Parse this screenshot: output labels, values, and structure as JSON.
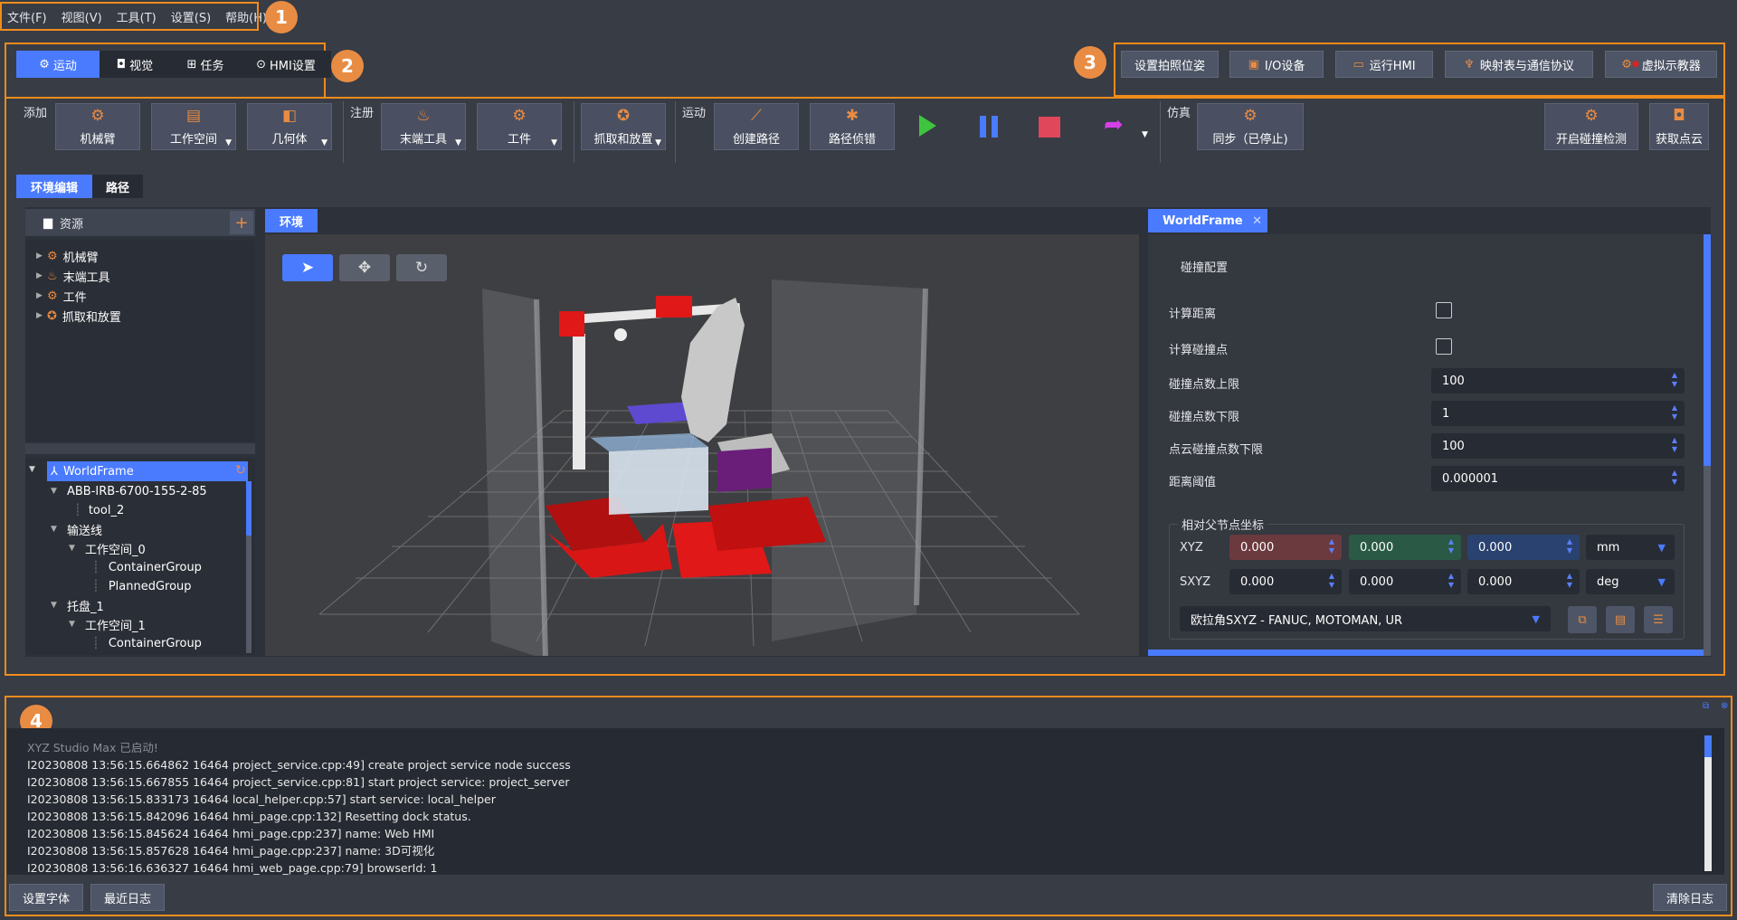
{
  "menu": [
    "文件(F)",
    "视图(V)",
    "工具(T)",
    "设置(S)",
    "帮助(H)"
  ],
  "badges": [
    "1",
    "2",
    "3",
    "4"
  ],
  "main_tabs": [
    {
      "label": "运动",
      "icon": "robot-arm-icon",
      "active": true
    },
    {
      "label": "视觉",
      "icon": "camera-icon",
      "active": false
    },
    {
      "label": "任务",
      "icon": "flow-icon",
      "active": false
    },
    {
      "label": "HMI设置",
      "icon": "play-circle-icon",
      "active": false
    }
  ],
  "top_buttons": [
    "设置拍照位姿",
    "I/O设备",
    "运行HMI",
    "映射表与通信协议",
    "虚拟示教器"
  ],
  "toolbar": {
    "add_label": "添加",
    "register_label": "注册",
    "motion_label": "运动",
    "sim_label": "仿真",
    "add": [
      "机械臂",
      "工作空间",
      "几何体"
    ],
    "register": [
      "末端工具",
      "工件",
      "抓取和放置"
    ],
    "motion": [
      "创建路径",
      "路径侦错"
    ],
    "sim": [
      "同步（已停止)"
    ],
    "right": [
      "开启碰撞检测",
      "获取点云"
    ]
  },
  "sub_tabs": [
    "环境编辑",
    "路径"
  ],
  "resources": {
    "title": "资源",
    "items": [
      "机械臂",
      "末端工具",
      "工件",
      "抓取和放置"
    ]
  },
  "scene_tree": [
    {
      "label": "WorldFrame",
      "level": 0,
      "selected": true
    },
    {
      "label": "ABB-IRB-6700-155-2-85",
      "level": 1
    },
    {
      "label": "tool_2",
      "level": 2
    },
    {
      "label": "输送线",
      "level": 1
    },
    {
      "label": "工作空间_0",
      "level": 2
    },
    {
      "label": "ContainerGroup",
      "level": 3
    },
    {
      "label": "PlannedGroup",
      "level": 3
    },
    {
      "label": "托盘_1",
      "level": 1
    },
    {
      "label": "工作空间_1",
      "level": 2
    },
    {
      "label": "ContainerGroup",
      "level": 3
    }
  ],
  "viewport": {
    "tab": "环境"
  },
  "props": {
    "tab": "WorldFrame",
    "section": "碰撞配置",
    "calc_distance": "计算距离",
    "calc_points": "计算碰撞点",
    "max_points_label": "碰撞点数上限",
    "max_points": "100",
    "min_points_label": "碰撞点数下限",
    "min_points": "1",
    "cloud_min_label": "点云碰撞点数下限",
    "cloud_min": "100",
    "threshold_label": "距离阈值",
    "threshold": "0.000001",
    "coord_title": "相对父节点坐标",
    "xyz_label": "XYZ",
    "xyz": [
      "0.000",
      "0.000",
      "0.000"
    ],
    "xyz_unit": "mm",
    "sxyz_label": "SXYZ",
    "sxyz": [
      "0.000",
      "0.000",
      "0.000"
    ],
    "sxyz_unit": "deg",
    "euler": "欧拉角SXYZ - FANUC, MOTOMAN, UR"
  },
  "log": {
    "lines": [
      "XYZ Studio Max 已启动!",
      "I20230808 13:56:15.664862 16464 project_service.cpp:49] create project service node success",
      "I20230808 13:56:15.667855 16464 project_service.cpp:81] start project service: project_server",
      "I20230808 13:56:15.833173 16464 local_helper.cpp:57] start service: local_helper",
      "I20230808 13:56:15.842096 16464 hmi_page.cpp:132] Resetting dock status.",
      "I20230808 13:56:15.845624 16464 hmi_page.cpp:237] name: Web HMI",
      "I20230808 13:56:15.857628 16464 hmi_page.cpp:237] name: 3D可视化",
      "I20230808 13:56:16.636327 16464 hmi_web_page.cpp:79] browserId: 1"
    ],
    "buttons": [
      "设置字体",
      "最近日志"
    ],
    "clear": "清除日志"
  },
  "colors": {
    "accent": "#4a7bff",
    "orange": "#f08c1c",
    "x": "#6b3a3f",
    "y": "#2a5a45",
    "z": "#2a4270"
  }
}
